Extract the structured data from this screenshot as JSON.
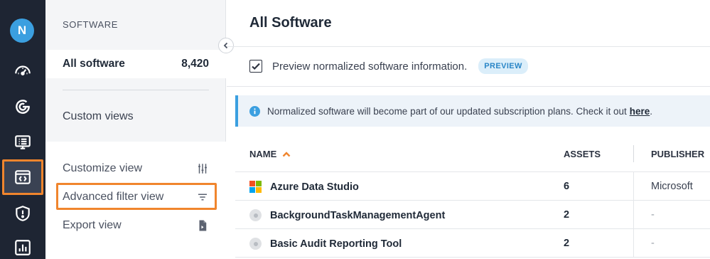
{
  "user": {
    "initial": "N"
  },
  "nav_icons": [
    "dashboard-icon",
    "scan-icon",
    "assets-icon",
    "software-icon",
    "security-icon",
    "reports-icon"
  ],
  "sidebar": {
    "heading": "SOFTWARE",
    "all": {
      "label": "All software",
      "count": "8,420"
    },
    "custom_views": "Custom views",
    "actions": [
      {
        "label": "Customize view",
        "icon": "sliders-icon"
      },
      {
        "label": "Advanced filter view",
        "icon": "filter-icon"
      },
      {
        "label": "Export view",
        "icon": "export-file-icon"
      }
    ]
  },
  "main": {
    "title": "All Software",
    "preview": {
      "label": "Preview normalized software information.",
      "badge": "PREVIEW",
      "checked": true
    },
    "notice": {
      "text": "Normalized software will become part of our updated subscription plans. Check it out",
      "link": "here",
      "suffix": "."
    },
    "table": {
      "columns": {
        "name": "NAME",
        "assets": "ASSETS",
        "publisher": "PUBLISHER"
      },
      "rows": [
        {
          "name": "Azure Data Studio",
          "assets": "6",
          "publisher": "Microsoft",
          "icon": "microsoft-logo"
        },
        {
          "name": "BackgroundTaskManagementAgent",
          "assets": "2",
          "publisher": "-",
          "icon": "generic-app-icon"
        },
        {
          "name": "Basic Audit Reporting Tool",
          "assets": "2",
          "publisher": "-",
          "icon": "generic-app-icon"
        }
      ]
    }
  },
  "colors": {
    "accent": "#f0852d",
    "rail": "#1e2533",
    "info": "#3b9fe0"
  }
}
